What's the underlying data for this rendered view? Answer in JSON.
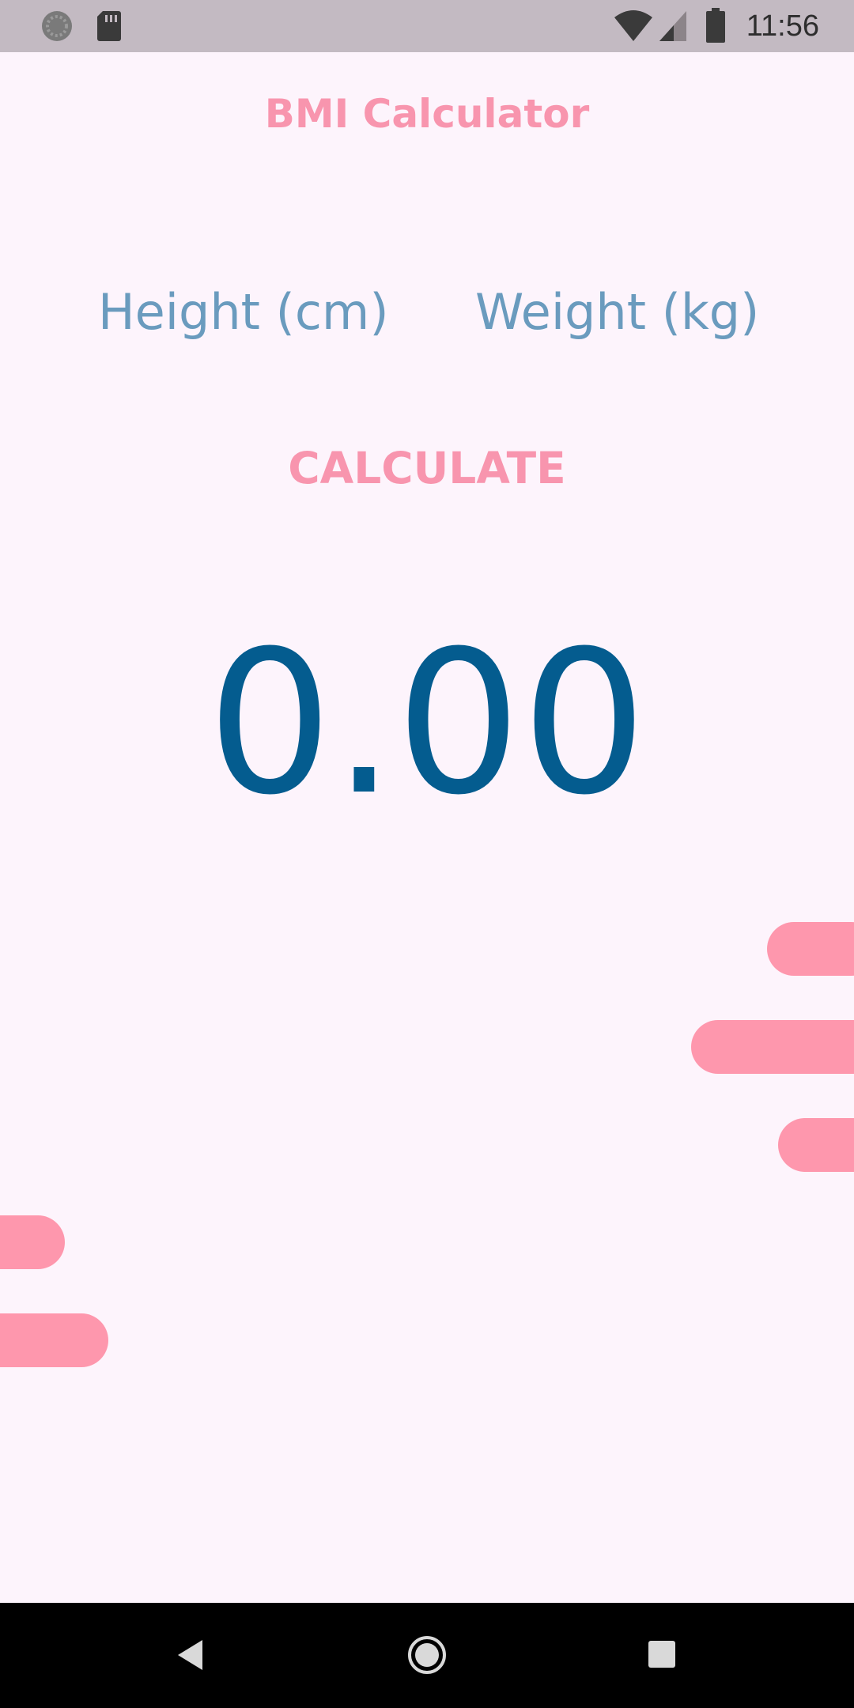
{
  "status_bar": {
    "time": "11:56",
    "icons": [
      "sync-icon",
      "sd-card-icon",
      "wifi-icon",
      "cell-signal-icon",
      "battery-icon"
    ]
  },
  "app": {
    "title": "BMI Calculator",
    "height_placeholder": "Height (cm)",
    "weight_placeholder": "Weight (kg)",
    "calculate_label": "CALCULATE",
    "result": "0.00"
  },
  "colors": {
    "background": "#fdf4fc",
    "accent_pink": "#f895ae",
    "hint_blue": "#6a9bbe",
    "result_blue": "#045c8f",
    "status_bar": "#c3bac2",
    "nav_bar": "#000000"
  },
  "nav_bar": {
    "icons": [
      "back-icon",
      "home-icon",
      "recents-icon"
    ]
  }
}
